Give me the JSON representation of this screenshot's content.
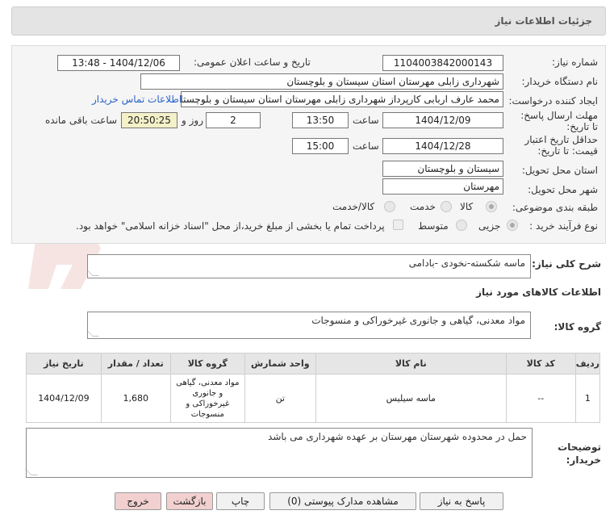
{
  "header": {
    "title": "جزئیات اطلاعات نیاز"
  },
  "form": {
    "need_number_label": "شماره نیاز:",
    "need_number": "1104003842000143",
    "announce_label": "تاریخ و ساعت اعلان عمومی:",
    "announce_value": "1404/12/06 - 13:48",
    "buyer_org_label": "نام دستگاه خریدار:",
    "buyer_org": "شهرداری زابلی مهرستان استان سیستان و بلوچستان",
    "creator_label": "ایجاد کننده درخواست:",
    "creator": "محمد عارف اربابی کارپرداز شهرداری زابلی مهرستان استان سیستان و بلوچستان",
    "contact_link": "اطلاعات تماس خریدار",
    "reply_deadline_label": "مهلت ارسال پاسخ: تا تاریخ:",
    "reply_date": "1404/12/09",
    "time_label": "ساعت",
    "reply_time": "13:50",
    "days_value": "2",
    "days_label": "روز و",
    "remaining_time": "20:50:25",
    "remaining_label": "ساعت باقی مانده",
    "validity_label": "حداقل تاریخ اعتبار قیمت: تا تاریخ:",
    "validity_date": "1404/12/28",
    "validity_time": "15:00",
    "province_label": "استان محل تحویل:",
    "province": "سیستان و بلوچستان",
    "city_label": "شهر محل تحویل:",
    "city": "مهرستان",
    "category_label": "طبقه بندی موضوعی:",
    "category_options": [
      "کالا",
      "خدمت",
      "کالا/خدمت"
    ],
    "process_label": "نوع فرآیند خرید :",
    "process_options": [
      "جزیی",
      "متوسط"
    ],
    "payment_note": "پرداخت تمام یا بخشی از مبلغ خرید،از محل \"اسناد خزانه اسلامی\" خواهد بود."
  },
  "summary": {
    "label": "شرح کلی نیاز:",
    "text": "ماسه شکسته-نخودی -بادامی"
  },
  "goods": {
    "section_title": "اطلاعات کالاهای مورد نیاز",
    "group_label": "گروه کالا:",
    "group_value": "مواد معدنی، گیاهی و جانوری غیرخوراکی و منسوجات",
    "columns": [
      "ردیف",
      "کد کالا",
      "نام کالا",
      "واحد شمارش",
      "گروه کالا",
      "تعداد / مقدار",
      "تاریخ نیاز"
    ],
    "rows": [
      {
        "row": "1",
        "code": "--",
        "name": "ماسه سیلیس",
        "unit": "تن",
        "group": "مواد معدنی، گیاهی و جانوری غیرخوراکی و منسوجات",
        "qty": "1,680",
        "date": "1404/12/09"
      }
    ]
  },
  "notes": {
    "label": "توضیحات خریدار:",
    "text": "حمل در محدوده شهرستان مهرستان بر  عهده شهرداری می باشد"
  },
  "buttons": {
    "reply": "پاسخ به نیاز",
    "docs": "مشاهده مدارک پیوستی (0)",
    "print": "چاپ",
    "back": "بازگشت",
    "exit": "خروج"
  },
  "watermark": {
    "text": "AriaTender.neT"
  },
  "colors": {
    "link": "#2a62c9",
    "header_bg": "#e4e4e4",
    "panel_bg": "#f5f5f5",
    "exit_button": "#f2d0d0",
    "remaining_bg": "#f4f0c8"
  }
}
